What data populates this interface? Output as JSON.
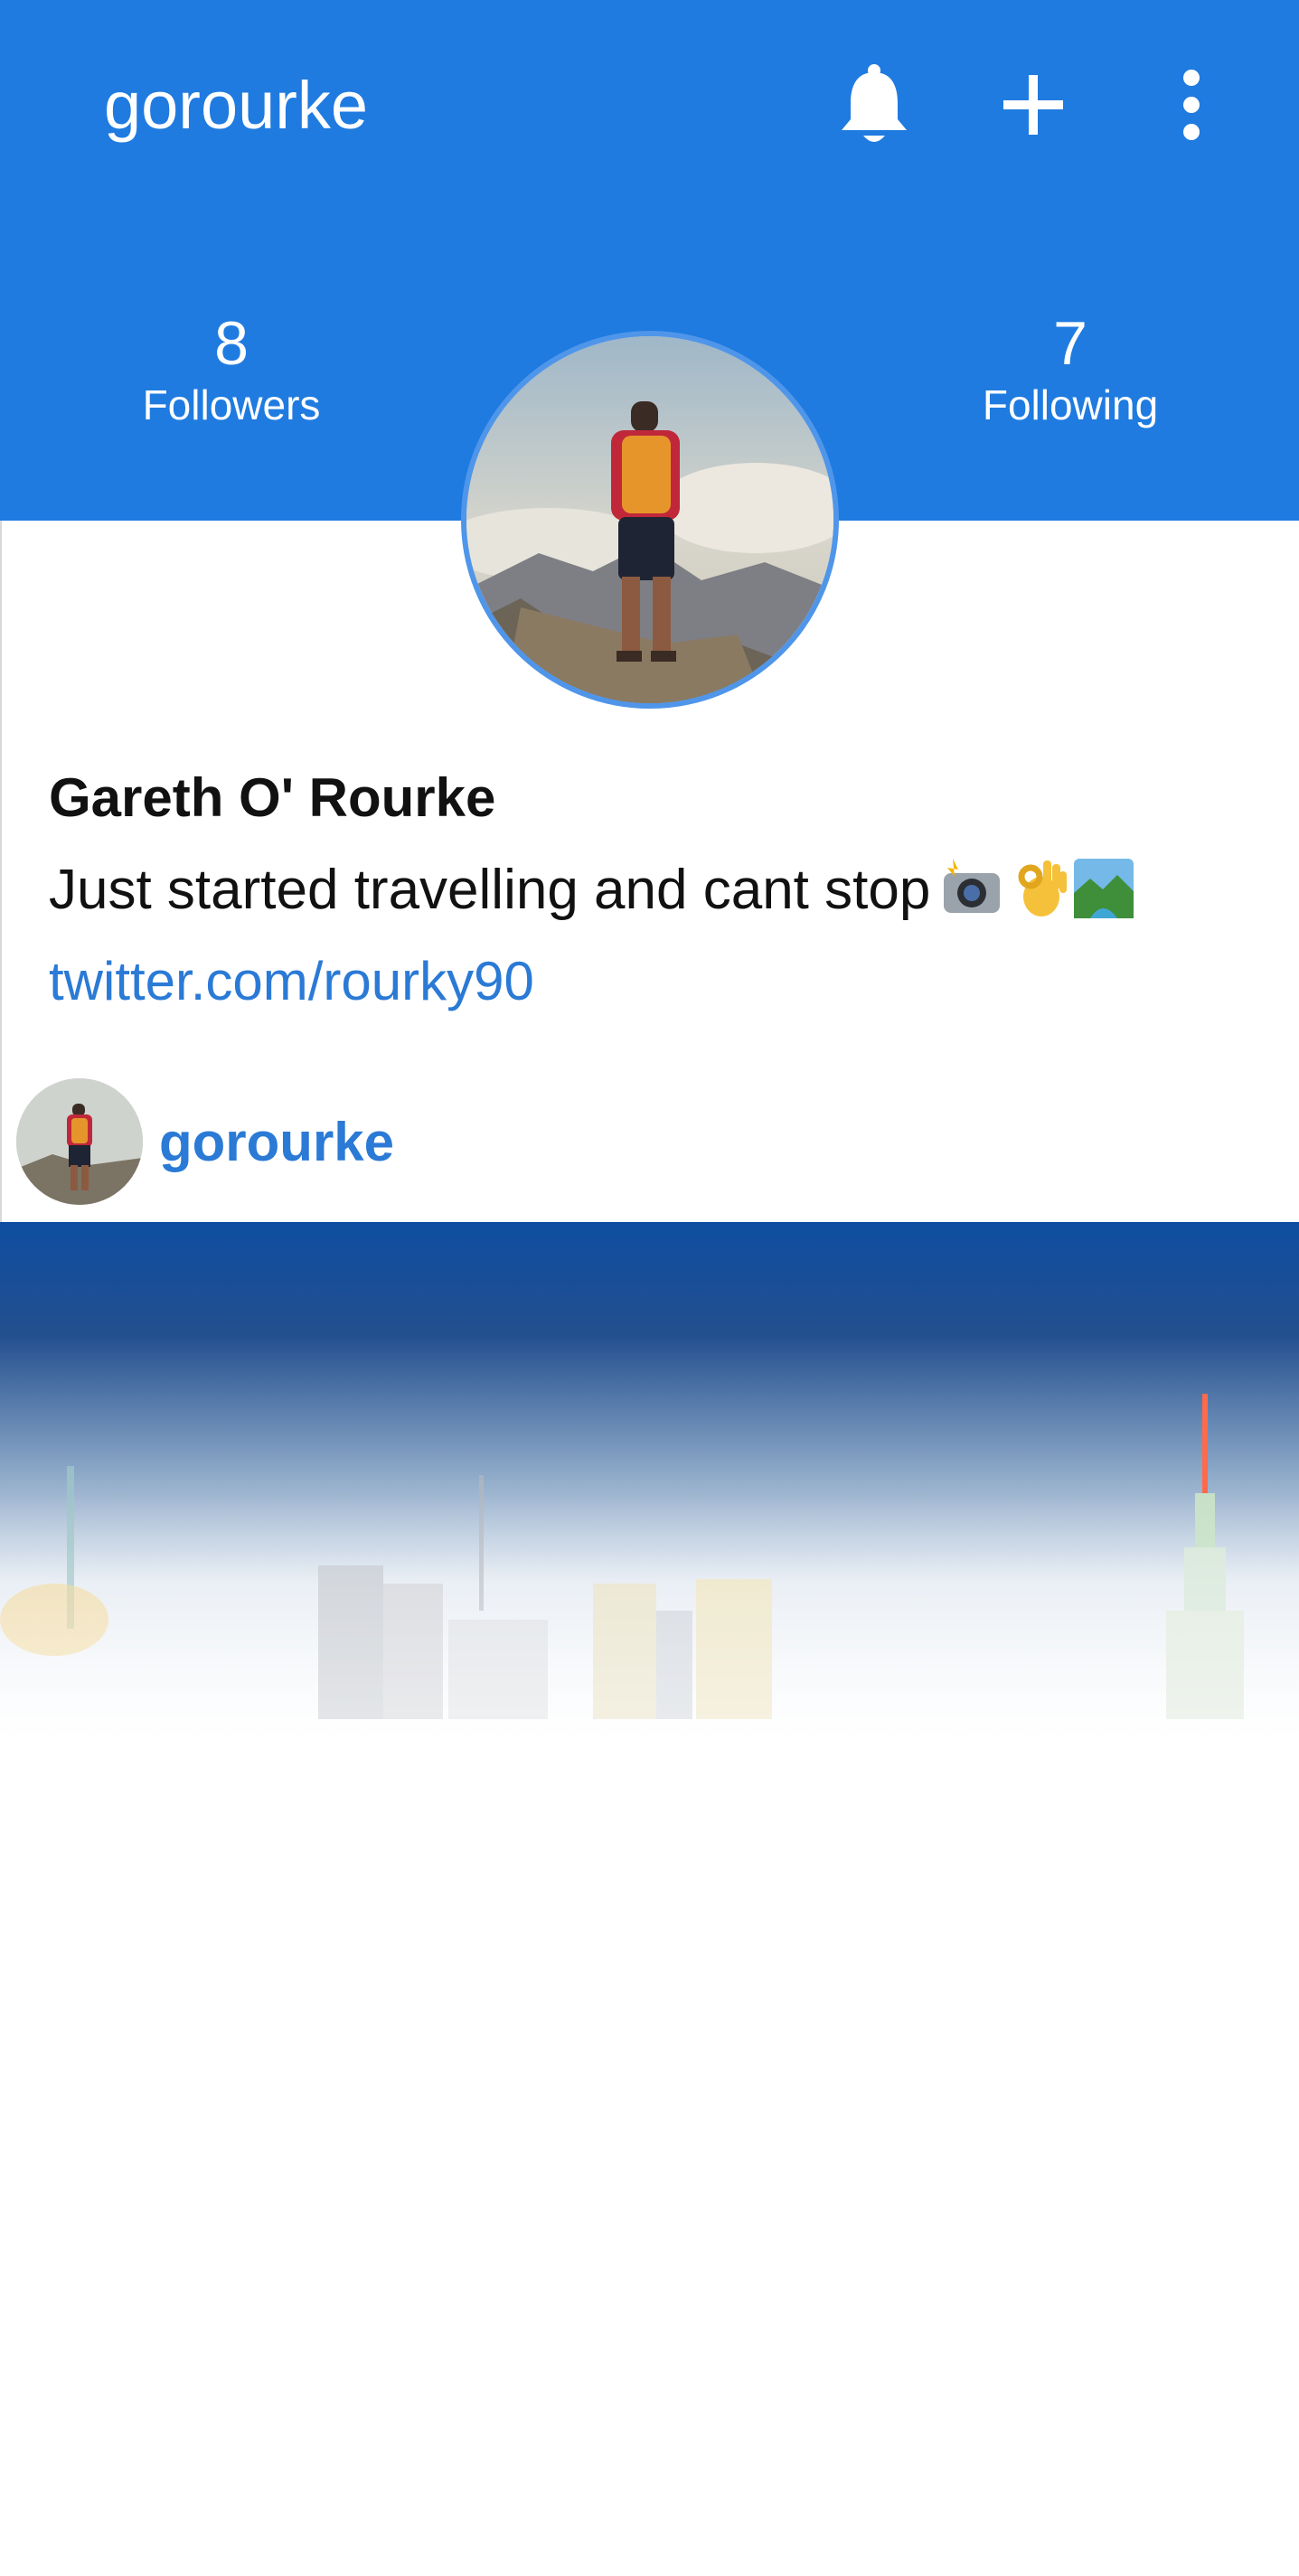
{
  "appbar": {
    "title": "gorourke",
    "actions": [
      {
        "icon": "bell-icon",
        "label": "notifications"
      },
      {
        "icon": "plus-icon",
        "label": "add"
      },
      {
        "icon": "more-vertical-icon",
        "label": "more options"
      }
    ],
    "color": "#1f7be0"
  },
  "stats": {
    "followers": {
      "count": "8",
      "label": "Followers"
    },
    "following": {
      "count": "7",
      "label": "Following"
    }
  },
  "profile": {
    "name": "Gareth O' Rourke",
    "bio": "Just started travelling and cant stop",
    "bio_emojis": [
      "camera-flash-icon",
      "ok-hand-icon",
      "national-park-icon"
    ],
    "link": "twitter.com/rourky90"
  },
  "post": {
    "username": "gorourke"
  },
  "colors": {
    "primary": "#1f7be0",
    "link": "#2a7ad6",
    "avatar_ring": "#4f96ea"
  }
}
